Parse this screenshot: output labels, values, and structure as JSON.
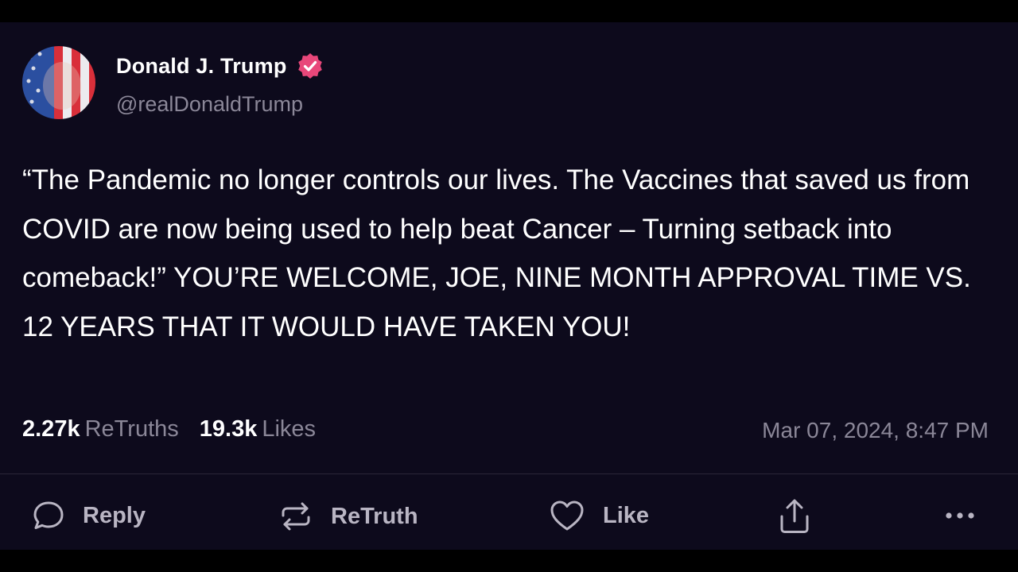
{
  "author": {
    "display_name": "Donald J. Trump",
    "handle": "@realDonaldTrump",
    "verified": true,
    "verified_color": "#e8477a"
  },
  "post": {
    "text": "“The Pandemic no longer controls our lives. The Vaccines that saved us from COVID are now being used to help beat Cancer – Turning setback into comeback!” YOU’RE WELCOME, JOE, NINE MONTH APPROVAL TIME VS. 12 YEARS THAT IT WOULD HAVE TAKEN YOU!",
    "retruths_count": "2.27k",
    "retruths_label": "ReTruths",
    "likes_count": "19.3k",
    "likes_label": "Likes",
    "timestamp": "Mar 07, 2024, 8:47 PM"
  },
  "actions": {
    "reply_label": "Reply",
    "retruth_label": "ReTruth",
    "like_label": "Like"
  },
  "icons": [
    "reply-icon",
    "retruth-icon",
    "heart-icon",
    "share-icon",
    "more-icon",
    "verified-icon"
  ],
  "colors": {
    "background": "#0d0a1c",
    "text": "#ffffff",
    "muted": "#8b8798",
    "accent": "#e8477a"
  }
}
